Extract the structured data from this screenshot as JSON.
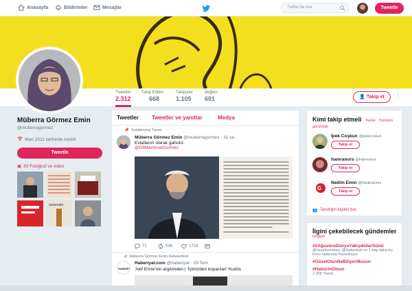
{
  "nav": {
    "home": "Anasayfa",
    "notifications": "Bildirimler",
    "messages": "Mesajlar"
  },
  "search": {
    "placeholder": "Twitter'da Ara"
  },
  "top_tweet_label": "Tweetle",
  "stats": [
    {
      "label": "Tweetler",
      "value": "2.312"
    },
    {
      "label": "Takip Edilen",
      "value": "668"
    },
    {
      "label": "Takipçiler",
      "value": "1.105"
    },
    {
      "label": "Beğeni",
      "value": "601"
    }
  ],
  "follow_label": "Takip et",
  "profile": {
    "name": "Müberra Görmez Emin",
    "handle": "@muberragormez",
    "joined": "Mart 2011 tarihinde katıldı",
    "tweet_label": "Tweetle",
    "photos_label": "83 Fotoğraf ve video"
  },
  "tabs": [
    "Tweetler",
    "Tweetler ve yanıtlar",
    "Medya"
  ],
  "tweet1": {
    "context": "Sabitlenmiş Tweet",
    "name": "Müberra Görmez Emin",
    "handle": "@muberragormez · 11 sa.",
    "text": "Evlatlanın olarak gahıdız.",
    "mention": "@DİBMehmetGormez",
    "replies": "71",
    "retweets": "536",
    "likes": "1728"
  },
  "tweet2": {
    "context": "Müberra Görmez Emin Retweetledi",
    "name": "Haberiyat.com",
    "handle": "@haberiyat · 29 Tem",
    "text": "'Akif Emre'nin argivinden | 'İçimizden koparılan' Kudüs"
  },
  "who_to_follow": {
    "title": "Kimi takip etmeli",
    "sub": "· Yenile · Tümünü görüntüle",
    "users": [
      {
        "name": "İpek Coşkun",
        "handle": "@ipekcoskun"
      },
      {
        "name": "hamranurs",
        "handle": "@Hamranur"
      },
      {
        "name": "Nedim Emin",
        "handle": "@NedimEmin"
      }
    ],
    "find_friends": "Tanıdığın kişileri bul"
  },
  "trends": {
    "title": "İlgini çekebilecek gündemler",
    "change": "Değiştir",
    "items": [
      {
        "tag": "#2AğustosDünyaYakışıklılarGünü",
        "desc": "@hasafscheben: @Haberturk ne 1 baş daha bu konu hakkında TweetSoyor"
      },
      {
        "tag": "#GüzelOlsnNeBiliyerMusun",
        "desc": ""
      },
      {
        "tag": "#HaborinOlsun",
        "desc": "2.358 Tweet"
      }
    ]
  },
  "colors": {
    "accent": "#e0245e",
    "banner": "#f4df1f",
    "link_blue": "#1da1f2"
  }
}
